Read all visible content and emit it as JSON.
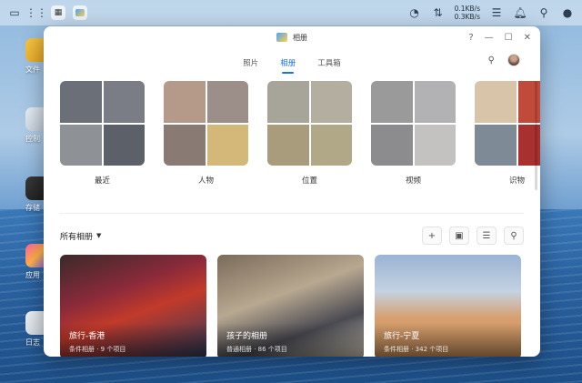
{
  "taskbar": {
    "net_up": "0.1KB/s",
    "net_down": "0.3KB/s"
  },
  "desktop": {
    "items": [
      {
        "label": "文件"
      },
      {
        "label": "控制"
      },
      {
        "label": "存储"
      },
      {
        "label": "应用"
      },
      {
        "label": "日志"
      }
    ]
  },
  "window": {
    "title": "相册",
    "help": "?",
    "minimize": "—",
    "maximize": "☐",
    "close": "✕"
  },
  "tabs": [
    {
      "label": "照片",
      "active": false
    },
    {
      "label": "相册",
      "active": true
    },
    {
      "label": "工具箱",
      "active": false
    }
  ],
  "albums": [
    {
      "label": "最近",
      "tiles": [
        "#6b6f78",
        "#7a7c86",
        "#8e9196",
        "#5c6068"
      ]
    },
    {
      "label": "人物",
      "tiles": [
        "#b59a8a",
        "#9c8e88",
        "#8a7a74",
        "#d4b87a"
      ]
    },
    {
      "label": "位置",
      "tiles": [
        "#a7a49a",
        "#b4aea0",
        "#a89c7c",
        "#b0a886"
      ]
    },
    {
      "label": "视频",
      "tiles": [
        "#9a9a9a",
        "#b2b2b4",
        "#8c8c8e",
        "#c4c2c0"
      ]
    },
    {
      "label": "识物",
      "tiles": [
        "#d8c4a8",
        "#c24a3a",
        "#7e8a96",
        "#a8302e"
      ]
    }
  ],
  "all_albums": {
    "title": "所有相册",
    "tools": [
      "+",
      "▣",
      "☰",
      "⚲"
    ]
  },
  "cards": [
    {
      "title": "旅行-香港",
      "sub": "条件相册 · 9 个项目",
      "bg": "linear-gradient(160deg,#3a2a2a 0%,#8a2a3a 35%,#c23a2a 55%,#2a3a5a 100%)"
    },
    {
      "title": "孩子的相册",
      "sub": "普通相册 · 86 个项目",
      "bg": "linear-gradient(160deg,#7a6a5a 0%,#b8a890 40%,#4a4a52 70%,#d8d0c0 100%)"
    },
    {
      "title": "旅行-宁夏",
      "sub": "条件相册 · 342 个项目",
      "bg": "linear-gradient(180deg,#9ab4d4 0%,#c4d2e2 35%,#d8a070 60%,#c8905a 100%)"
    }
  ],
  "colors": {
    "accent": "#1a73e8"
  }
}
